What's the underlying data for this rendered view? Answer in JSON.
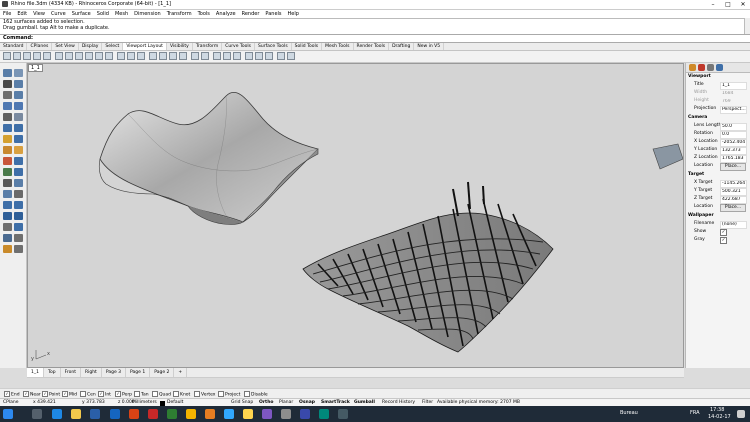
{
  "window": {
    "title": "Rhino file.3dm (4334 KB) - Rhinoceros Corporate (64-bit) - [1_1]",
    "controls": [
      "–",
      "□",
      "✕"
    ]
  },
  "menu": [
    "File",
    "Edit",
    "View",
    "Curve",
    "Surface",
    "Solid",
    "Mesh",
    "Dimension",
    "Transform",
    "Tools",
    "Analyze",
    "Render",
    "Panels",
    "Help"
  ],
  "command_history": [
    "162 surfaces added to selection.",
    "Drag gumball. tap Alt to make a duplicate."
  ],
  "command_prompt": "Command:",
  "toolbar_tabs": [
    "Standard",
    "CPlanes",
    "Set View",
    "Display",
    "Select",
    "Viewport Layout",
    "Visibility",
    "Transform",
    "Curve Tools",
    "Surface Tools",
    "Solid Tools",
    "Mesh Tools",
    "Render Tools",
    "Drafting",
    "New in V5"
  ],
  "active_toolbar_tab": "Viewport Layout",
  "viewport": {
    "title": "1_1",
    "axis_x": "x",
    "axis_y": "y"
  },
  "properties": {
    "viewport_section": "Viewport",
    "title_label": "Title",
    "title_value": "1_1",
    "width_label": "Width",
    "width_value": "1684",
    "height_label": "Height",
    "height_value": "769",
    "projection_label": "Projection",
    "projection_value": "Perspect...",
    "camera_section": "Camera",
    "lens_length_label": "Lens Length",
    "lens_length_value": "50.0",
    "rotation_label": "Rotation",
    "rotation_value": "0.0",
    "x_location_label": "X Location",
    "x_location_value": "-2052.404",
    "y_location_label": "Y Location",
    "y_location_value": "132.373",
    "z_location_label": "Z Location",
    "z_location_value": "1765.183",
    "location_label": "Location",
    "place_button": "Place...",
    "target_section": "Target",
    "x_target_label": "X Target",
    "x_target_value": "-1145.264",
    "y_target_label": "Y Target",
    "y_target_value": "500.321",
    "z_target_label": "Z Target",
    "z_target_value": "422.687",
    "target_location_label": "Location",
    "target_place_button": "Place...",
    "wallpaper_section": "Wallpaper",
    "filename_label": "Filename",
    "filename_value": "(none)",
    "show_label": "Show",
    "show_checked": "✓",
    "gray_label": "Gray",
    "gray_checked": "✓"
  },
  "viewport_tabs": [
    "1_1",
    "Top",
    "Front",
    "Right",
    "Page 3",
    "Page 1",
    "Page 2",
    "+"
  ],
  "active_viewport_tab": "1_1",
  "osnaps": [
    {
      "label": "End",
      "checked": true
    },
    {
      "label": "Near",
      "checked": true
    },
    {
      "label": "Point",
      "checked": true
    },
    {
      "label": "Mid",
      "checked": true
    },
    {
      "label": "Cen",
      "checked": false
    },
    {
      "label": "Int",
      "checked": true
    },
    {
      "label": "Perp",
      "checked": true
    },
    {
      "label": "Tan",
      "checked": false
    },
    {
      "label": "Quad",
      "checked": false
    },
    {
      "label": "Knot",
      "checked": false
    },
    {
      "label": "Vertex",
      "checked": false
    },
    {
      "label": "Project",
      "checked": false
    },
    {
      "label": "Disable",
      "checked": false
    }
  ],
  "status": {
    "cplane": "CPlane",
    "x": "x 439.421",
    "y": "y 373.783",
    "z": "z 0.000",
    "units": "Millimeters",
    "layer": "Default",
    "grid_snap": "Grid Snap",
    "ortho": "Ortho",
    "planar": "Planar",
    "osnap": "Osnap",
    "smarttrack": "SmartTrack",
    "gumball": "Gumball",
    "record_history": "Record History",
    "filter": "Filter",
    "memory": "Available physical memory: 2707 MB"
  },
  "taskbar": {
    "language": "Bureau",
    "input": "FRA",
    "time": "17:38",
    "date": "14-02-17"
  },
  "colors": {
    "viewport_bg": "#d4d4d4",
    "taskbar": "#1f2b38"
  }
}
